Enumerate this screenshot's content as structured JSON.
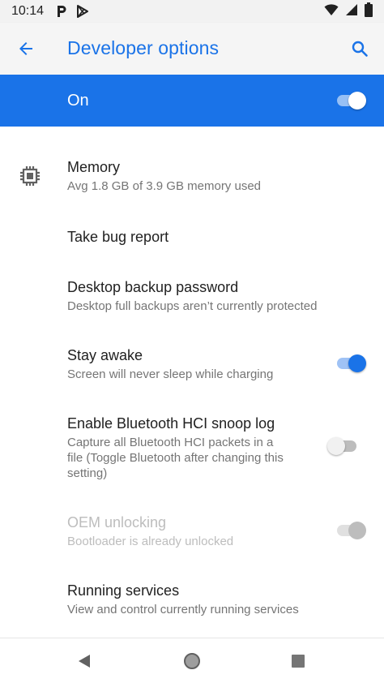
{
  "status_bar": {
    "time": "10:14",
    "left_icons": [
      "p-notification-icon",
      "play-store-icon"
    ],
    "right_icons": [
      "wifi-icon",
      "signal-icon",
      "battery-icon"
    ]
  },
  "app_bar": {
    "title": "Developer options",
    "back_icon": "arrow-back-icon",
    "search_icon": "search-icon"
  },
  "master_switch": {
    "label": "On",
    "checked": true
  },
  "items": [
    {
      "title": "Memory",
      "summary": "Avg 1.8 GB of 3.9 GB memory used",
      "icon": "memory-chip-icon"
    },
    {
      "title": "Take bug report"
    },
    {
      "title": "Desktop backup password",
      "summary": "Desktop full backups aren’t currently protected"
    },
    {
      "title": "Stay awake",
      "summary": "Screen will never sleep while charging",
      "checked": true
    },
    {
      "title": "Enable Bluetooth HCI snoop log",
      "summary_lines": [
        "Capture all Bluetooth HCI packets in a",
        "file (Toggle Bluetooth after changing this",
        "setting)"
      ],
      "checked": false
    },
    {
      "title": "OEM unlocking",
      "summary": "Bootloader is already unlocked",
      "checked": true,
      "disabled": true
    },
    {
      "title": "Running services",
      "summary": "View and control currently running services"
    }
  ],
  "nav_bar": {
    "icons": [
      "back-triangle-icon",
      "home-circle-icon",
      "recents-square-icon"
    ]
  },
  "colors": {
    "accent": "#1a73e8",
    "app_bar_bg": "#f5f5f5",
    "status_bar_bg": "#f2f2f2",
    "secondary_text": "#757575",
    "disabled_text": "#bdbdbd"
  }
}
